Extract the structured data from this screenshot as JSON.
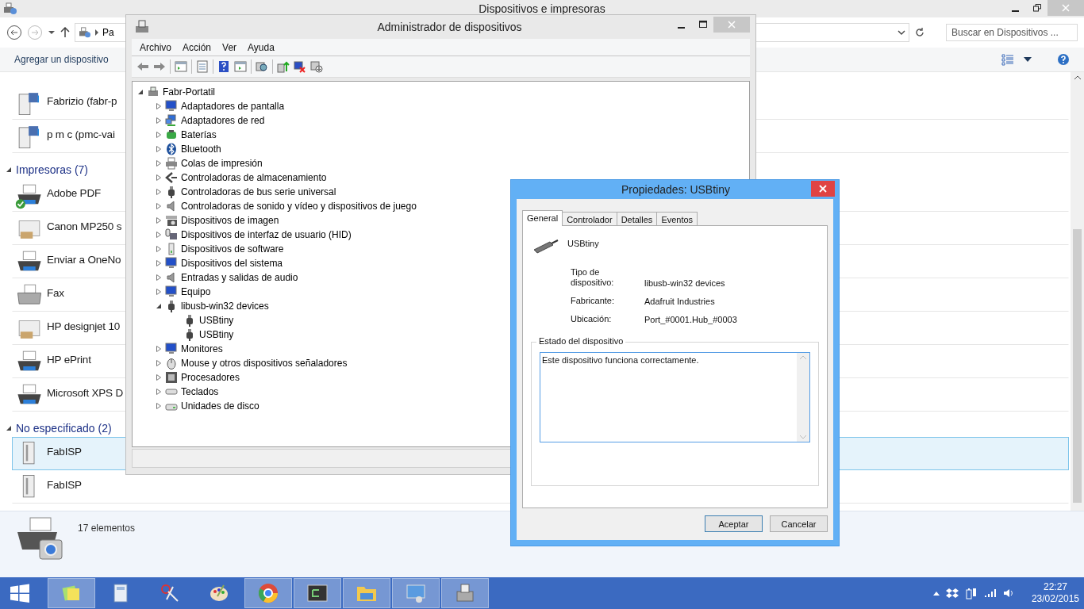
{
  "explorer": {
    "title": "Dispositivos e impresoras",
    "address": "Pa",
    "search": {
      "placeholder": "Buscar en Dispositivos ..."
    },
    "command": "Agregar un dispositivo",
    "top_items": [
      {
        "name": "Fabrizio (fabr-p",
        "kind": "media-pc",
        "selected": false
      },
      {
        "name": "p m c (pmc-vai",
        "kind": "media-pc",
        "selected": false
      }
    ],
    "groups": [
      {
        "label": "Impresoras (7)",
        "expanded": true,
        "items": [
          {
            "name": "Adobe PDF",
            "kind": "printer",
            "default": true,
            "selected": false
          },
          {
            "name": "Canon MP250 s",
            "kind": "mfp",
            "default": false,
            "selected": false
          },
          {
            "name": "Enviar a OneNo",
            "kind": "printer",
            "default": false,
            "selected": false
          },
          {
            "name": "Fax",
            "kind": "fax",
            "default": false,
            "selected": false
          },
          {
            "name": "HP designjet 10",
            "kind": "mfp",
            "default": false,
            "selected": false
          },
          {
            "name": "HP ePrint",
            "kind": "printer",
            "default": false,
            "selected": false
          },
          {
            "name": "Microsoft XPS D",
            "kind": "printer",
            "default": false,
            "selected": false
          }
        ]
      },
      {
        "label": "No especificado (2)",
        "expanded": true,
        "items": [
          {
            "name": "FabISP",
            "kind": "device",
            "default": false,
            "selected": true
          },
          {
            "name": "FabISP",
            "kind": "device",
            "default": false,
            "selected": false
          }
        ]
      }
    ],
    "status": "17 elementos"
  },
  "device_manager": {
    "title": "Administrador de dispositivos",
    "menu": [
      "Archivo",
      "Acción",
      "Ver",
      "Ayuda"
    ],
    "tree": {
      "label": "Fabr-Portatil",
      "kind": "computer",
      "expanded": true,
      "children": [
        {
          "label": "Adaptadores de pantalla",
          "kind": "display",
          "expanded": false
        },
        {
          "label": "Adaptadores de red",
          "kind": "network",
          "expanded": false
        },
        {
          "label": "Baterías",
          "kind": "battery",
          "expanded": false
        },
        {
          "label": "Bluetooth",
          "kind": "bluetooth",
          "expanded": false
        },
        {
          "label": "Colas de impresión",
          "kind": "printer",
          "expanded": false
        },
        {
          "label": "Controladoras de almacenamiento",
          "kind": "storage",
          "expanded": false
        },
        {
          "label": "Controladoras de bus serie universal",
          "kind": "usb",
          "expanded": false
        },
        {
          "label": "Controladoras de sonido y vídeo y dispositivos de juego",
          "kind": "sound",
          "expanded": false
        },
        {
          "label": "Dispositivos de imagen",
          "kind": "camera",
          "expanded": false
        },
        {
          "label": "Dispositivos de interfaz de usuario (HID)",
          "kind": "hid",
          "expanded": false
        },
        {
          "label": "Dispositivos de software",
          "kind": "software",
          "expanded": false
        },
        {
          "label": "Dispositivos del sistema",
          "kind": "display",
          "expanded": false
        },
        {
          "label": "Entradas y salidas de audio",
          "kind": "sound",
          "expanded": false
        },
        {
          "label": "Equipo",
          "kind": "display",
          "expanded": false
        },
        {
          "label": "libusb-win32 devices",
          "kind": "usb",
          "expanded": true,
          "children": [
            {
              "label": "USBtiny",
              "kind": "usb"
            },
            {
              "label": "USBtiny",
              "kind": "usb"
            }
          ]
        },
        {
          "label": "Monitores",
          "kind": "display",
          "expanded": false
        },
        {
          "label": "Mouse y otros dispositivos señaladores",
          "kind": "mouse",
          "expanded": false
        },
        {
          "label": "Procesadores",
          "kind": "cpu",
          "expanded": false
        },
        {
          "label": "Teclados",
          "kind": "keyboard",
          "expanded": false
        },
        {
          "label": "Unidades de disco",
          "kind": "disk",
          "expanded": false
        }
      ]
    }
  },
  "dialog": {
    "title": "Propiedades: USBtiny",
    "tabs": [
      {
        "label": "General",
        "selected": true
      },
      {
        "label": "Controlador",
        "selected": false
      },
      {
        "label": "Detalles",
        "selected": false
      },
      {
        "label": "Eventos",
        "selected": false
      }
    ],
    "device_name": "USBtiny",
    "fields": [
      {
        "label": "Tipo de dispositivo:",
        "value": "libusb-win32 devices"
      },
      {
        "label": "Fabricante:",
        "value": "Adafruit Industries"
      },
      {
        "label": "Ubicación:",
        "value": "Port_#0001.Hub_#0003"
      }
    ],
    "status_group": "Estado del dispositivo",
    "status_text": "Este dispositivo funciona correctamente.",
    "buttons": [
      {
        "label": "Aceptar",
        "default": true
      },
      {
        "label": "Cancelar",
        "default": false
      }
    ]
  },
  "taskbar": {
    "apps": [
      {
        "kind": "notes",
        "open": true
      },
      {
        "kind": "calculator",
        "open": false
      },
      {
        "kind": "scissors",
        "open": false
      },
      {
        "kind": "paint",
        "open": false
      },
      {
        "kind": "browser",
        "open": true
      },
      {
        "kind": "terminal",
        "open": true
      },
      {
        "kind": "folder",
        "open": true
      },
      {
        "kind": "control-panel",
        "open": true
      },
      {
        "kind": "device-manager",
        "open": true
      }
    ],
    "time": "22:27",
    "date": "23/02/2015"
  }
}
